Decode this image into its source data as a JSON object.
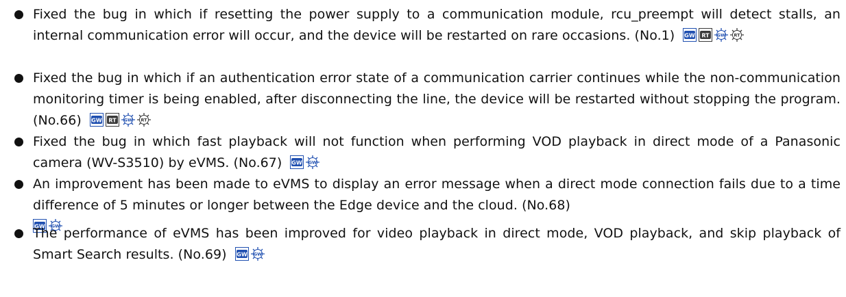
{
  "items": [
    {
      "text": "Fixed the bug in which if resetting the power supply to a communication module, rcu_preempt will detect stalls, an internal communication error will occur, and the device will be restarted on rare occasions. (No.1)",
      "badges": [
        "GW",
        "RT",
        "GW",
        "RT"
      ]
    },
    {
      "text": "Fixed the bug in which if an authentication error state of a communication carrier continues while the non-communication monitoring timer is being enabled, after disconnecting the line, the device will be restarted without stopping the program. (No.66)",
      "badges": [
        "GW",
        "RT",
        "GW",
        "RT"
      ]
    },
    {
      "text": "Fixed the bug in which fast playback will not function when performing VOD playback in direct mode of a Panasonic camera (WV-S3510) by eVMS. (No.67)",
      "badges": [
        "GW",
        "GW"
      ]
    },
    {
      "text": "An improvement has been made to eVMS to display an error message when a direct mode connection fails due to a time difference of 5 minutes or longer between the Edge device and the cloud. (No.68)",
      "badges": [
        "GW",
        "GW"
      ]
    },
    {
      "text": "The performance of eVMS has been improved for video playback in direct mode, VOD playback, and skip playback of Smart Search results. (No.69)",
      "badges": [
        "GW",
        "GW"
      ]
    }
  ],
  "colors": {
    "gw_badge": "#1f4fb0",
    "rt_badge": "#3a3a3a",
    "bullet": "#111111"
  }
}
